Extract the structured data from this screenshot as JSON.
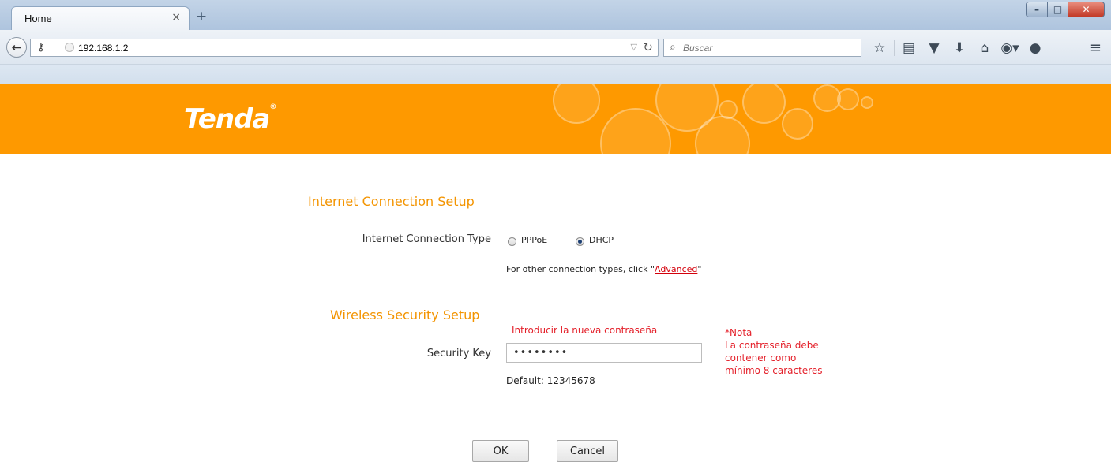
{
  "browser": {
    "tab_title": "Home",
    "url": "192.168.1.2",
    "search_placeholder": "Buscar",
    "toolbar_icons": [
      "star-icon",
      "reading-list-icon",
      "pocket-icon",
      "download-icon",
      "home-icon",
      "addon-icon",
      "chat-icon"
    ]
  },
  "banner": {
    "logo_text": "Tenda",
    "logo_mark": "®",
    "background_color": "#fe9900"
  },
  "internet": {
    "title": "Internet Connection Setup",
    "type_label": "Internet Connection Type",
    "options": [
      {
        "label": "PPPoE",
        "selected": false
      },
      {
        "label": "DHCP",
        "selected": true
      }
    ],
    "hint_prefix": "For other connection types, click \"",
    "hint_link": "Advanced",
    "hint_suffix": "\""
  },
  "wireless": {
    "title": "Wireless Security Setup",
    "annotation": "Introducir la nueva contraseña",
    "key_label": "Security Key",
    "key_value": "••••••••",
    "default_text": "Default: 12345678",
    "note_lines": [
      "*Nota",
      "La contraseña debe",
      "contener como",
      "mínimo 8 caracteres"
    ]
  },
  "buttons": {
    "ok": "OK",
    "cancel": "Cancel"
  },
  "colors": {
    "accent_orange": "#f39400",
    "note_red": "#e4202a",
    "link_red": "#d4000b"
  }
}
